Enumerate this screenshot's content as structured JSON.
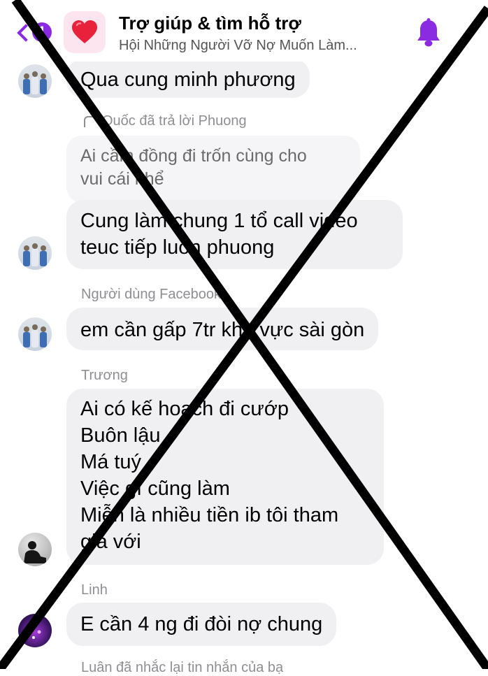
{
  "header": {
    "unread_count": "1",
    "title": "Trợ giúp & tìm hỗ trợ",
    "subtitle": "Hội Những Người Vỡ Nợ Muốn Làm..."
  },
  "messages": [
    {
      "lines": [
        "Qua cung minh phương"
      ]
    },
    {
      "reply_context": "Quốc đã trả lời Phuong",
      "quoted_lines": [
        "Ai cầm đồng đi trốn cùng cho",
        "vui cái nhể"
      ],
      "lines": [
        "Cung làm chung 1 tổ call video",
        "teuc tiếp luon phuong"
      ]
    },
    {
      "sender": "Người dùng Facebook",
      "lines": [
        "em cần gấp 7tr khu vực sài gòn"
      ]
    },
    {
      "sender": "Trương",
      "lines": [
        "Ai có kế hoạch đi cướp",
        "Buôn lậu",
        "Má tuý",
        "Việc gì cũng làm",
        "Miễn là nhiều tiền ib tôi tham",
        "gia với"
      ]
    },
    {
      "sender": "Linh",
      "lines": [
        "E cần 4 ng đi đòi nợ chung"
      ]
    }
  ],
  "footer_text": "Luân đã nhắc lại tin nhắn của bạ",
  "colors": {
    "accent": "#8a2be2",
    "bubble": "#f0f0f2",
    "cross": "#000000"
  },
  "icons": {
    "back": "chevron-left-icon",
    "group": "heart-icon",
    "notifications": "bell-icon"
  }
}
